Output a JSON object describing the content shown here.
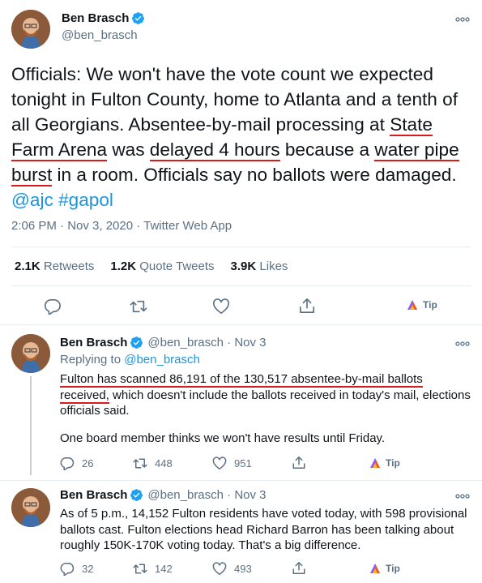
{
  "main": {
    "name": "Ben Brasch",
    "handle": "@ben_brasch",
    "text_parts": [
      "Officials: We won't have the vote count we expected tonight in Fulton County, home to Atlanta and a tenth of all Georgians. Absentee-by-mail processing at ",
      "State Farm Arena",
      " was ",
      "delayed 4 hours",
      " because a ",
      "water pipe burst",
      " in a room. Officials say no ballots were damaged. ",
      "@ajc #gapol"
    ],
    "timestamp": "2:06 PM · Nov 3, 2020 · Twitter Web App",
    "stats": {
      "retweets_count": "2.1K",
      "retweets_label": "Retweets",
      "quotes_count": "1.2K",
      "quotes_label": "Quote Tweets",
      "likes_count": "3.9K",
      "likes_label": "Likes"
    },
    "tip_label": "Tip"
  },
  "reply1": {
    "name": "Ben Brasch",
    "handle_date": "@ben_brasch · Nov 3",
    "replying_prefix": "Replying to ",
    "replying_handle": "@ben_brasch",
    "text_highlight": "Fulton has scanned 86,191 of the 130,517 absentee-by-mail ballots received,",
    "text_rest": " which doesn't include the ballots received in today's mail, elections officials said.",
    "text_para2": "One board member thinks we won't have results until Friday.",
    "replies": "26",
    "retweets": "448",
    "likes": "951",
    "tip_label": "Tip"
  },
  "reply2": {
    "name": "Ben Brasch",
    "handle_date": "@ben_brasch · Nov 3",
    "text": "As of 5 p.m., 14,152 Fulton residents have voted today, with 598 provisional ballots cast. Fulton elections head Richard Barron has been talking about roughly 150K-170K voting today. That's a big difference.",
    "replies": "32",
    "retweets": "142",
    "likes": "493",
    "tip_label": "Tip"
  },
  "colors": {
    "accent": "#1b95e0",
    "highlight_underline": "#d81b1b",
    "secondary_text": "#5b7083",
    "verified": "#1da1f2"
  }
}
